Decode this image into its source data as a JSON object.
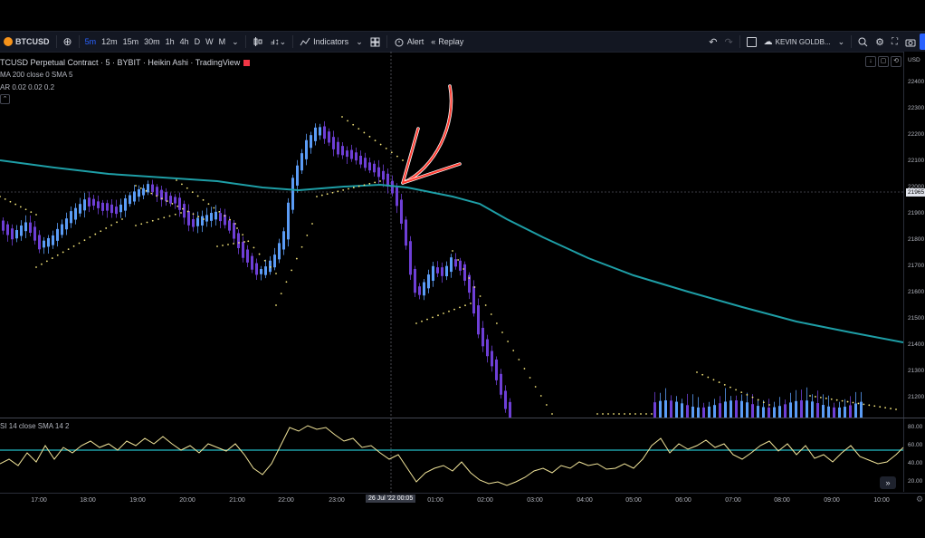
{
  "toolbar": {
    "symbol": "BTCUSD",
    "add_symbol": "⊕",
    "intervals": [
      "5m",
      "12m",
      "15m",
      "30m",
      "1h",
      "4h",
      "D",
      "W",
      "M"
    ],
    "active_interval": "5m",
    "indicators_label": "Indicators",
    "alert_label": "Alert",
    "replay_label": "Replay",
    "user_label": "KEVIN GOLDB..."
  },
  "legend": {
    "title": "TCUSD Perpetual Contract · 5 · BYBIT · Heikin Ashi · TradingView",
    "ma": "MA 200 close 0 SMA 5",
    "sar": "AR 0.02 0.02 0.2"
  },
  "rsi": {
    "label": "SI 14 close SMA 14 2",
    "ticks": [
      {
        "value": "80.00",
        "level": 80
      },
      {
        "value": "60.00",
        "level": 60
      },
      {
        "value": "40.00",
        "level": 40
      },
      {
        "value": "20.00",
        "level": 20
      }
    ]
  },
  "price_axis": {
    "currency": "USD",
    "ticks": [
      "22400",
      "22300",
      "22200",
      "22100",
      "22000",
      "21900",
      "21800",
      "21700",
      "21600",
      "21500",
      "21400",
      "21300",
      "21200"
    ],
    "current_price": "21965"
  },
  "time_axis": {
    "labels": [
      "17:00",
      "18:00",
      "19:00",
      "20:00",
      "21:00",
      "22:00",
      "23:00",
      "01:00",
      "02:00",
      "03:00",
      "04:00",
      "05:00",
      "06:00",
      "07:00",
      "08:00",
      "09:00",
      "10:00"
    ],
    "crosshair": "26 Jul '22   00:05"
  },
  "colors": {
    "ma_line": "#1e9ea6",
    "bull": "#5b9cf6",
    "bear": "#6e3fd6",
    "sar": "#f5e57a",
    "rsi_line": "#f2e59a",
    "rsi_mid": "#1e9ea6",
    "annotation": "#ff3b30"
  }
}
